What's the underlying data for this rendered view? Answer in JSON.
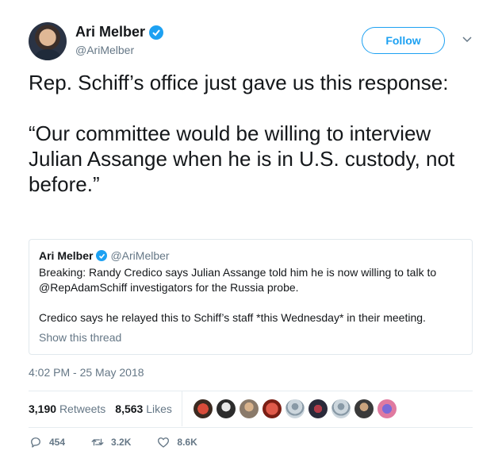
{
  "author": {
    "name": "Ari Melber",
    "handle": "@AriMelber"
  },
  "follow_label": "Follow",
  "tweet_text": "Rep. Schiff’s office just gave us this response:\n\n“Our committee would be willing to interview Julian Assange when he is in U.S. custody, not before.”",
  "quoted_tweet": {
    "name": "Ari Melber",
    "handle": "@AriMelber",
    "text": "Breaking: Randy Credico says Julian Assange told him he is now willing to talk to @RepAdamSchiff investigators for the Russia probe.\n\nCredico says he relayed this to Schiff’s staff *this Wednesday* in their meeting.",
    "thread_link": "Show this thread"
  },
  "timestamp": "4:02 PM - 25 May 2018",
  "stats": {
    "retweets_count": "3,190",
    "retweets_label": "Retweets",
    "likes_count": "8,563",
    "likes_label": "Likes"
  },
  "liker_avatars": [
    "avatar-1",
    "avatar-2",
    "avatar-3",
    "avatar-4",
    "avatar-5",
    "avatar-6",
    "avatar-7",
    "avatar-8",
    "avatar-9"
  ],
  "actions": {
    "replies": "454",
    "retweets": "3.2K",
    "likes": "8.6K"
  },
  "colors": {
    "accent": "#1da1f2",
    "secondary_text": "#657786",
    "primary_text": "#14171a"
  }
}
